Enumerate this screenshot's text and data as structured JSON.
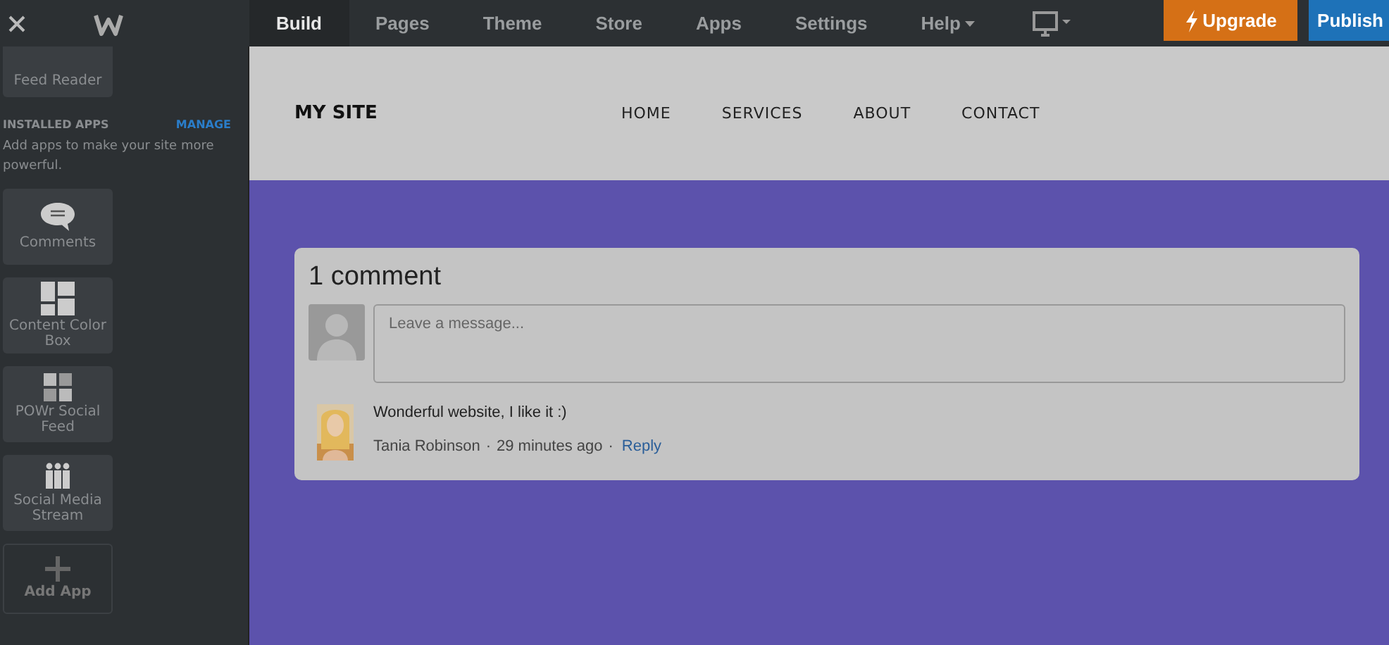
{
  "topbar": {
    "tabs": [
      {
        "label": "Build",
        "selected": true,
        "dropdown": false
      },
      {
        "label": "Pages",
        "selected": false,
        "dropdown": false
      },
      {
        "label": "Theme",
        "selected": false,
        "dropdown": false
      },
      {
        "label": "Store",
        "selected": false,
        "dropdown": false
      },
      {
        "label": "Apps",
        "selected": false,
        "dropdown": false
      },
      {
        "label": "Settings",
        "selected": false,
        "dropdown": false
      },
      {
        "label": "Help",
        "selected": false,
        "dropdown": true
      }
    ],
    "upgrade": "Upgrade",
    "publish": "Publish"
  },
  "sidebar": {
    "top_tile": {
      "label": "Feed Reader"
    },
    "section_title": "INSTALLED APPS",
    "manage": "MANAGE",
    "description": "Add apps to make your site more powerful.",
    "apps": [
      {
        "kind": "comments",
        "label": "Comments"
      },
      {
        "kind": "colorbox",
        "label": "Content Color Box"
      },
      {
        "kind": "feed",
        "label": "POWr Social Feed"
      },
      {
        "kind": "people",
        "label": "Social Media Stream"
      }
    ],
    "add": "Add App"
  },
  "site": {
    "title": "MY SITE",
    "nav": [
      "HOME",
      "SERVICES",
      "ABOUT",
      "CONTACT"
    ]
  },
  "comments": {
    "heading": "1 comment",
    "placeholder": "Leave a message...",
    "items": [
      {
        "text": "Wonderful website, I like it :)",
        "author": "Tania Robinson",
        "separators": [
          "·",
          "·"
        ],
        "time": "29 minutes ago",
        "reply": "Reply"
      }
    ]
  }
}
